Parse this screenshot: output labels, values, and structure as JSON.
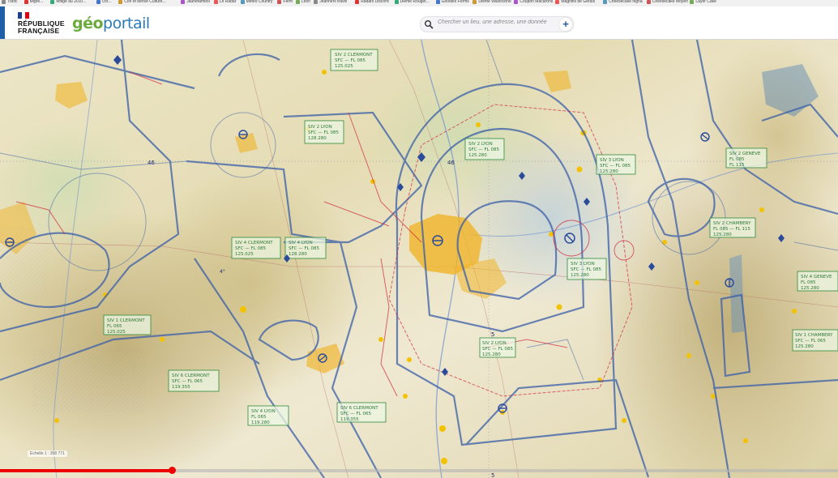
{
  "bookmarks": [
    "Trafic",
    "Migre...",
    "Mitigé au 2010...",
    "Oct...",
    "Cori et dérivé Culture...",
    "Jaunetambol",
    "Le Radar",
    "Meteo Country",
    "Ferm",
    "Leon",
    "Jeanners travel",
    "Radars Discord",
    "Dieme Rouget...",
    "Goodies Forms",
    "Dieme Wazeclone",
    "Coupon Macarons",
    "Magnifis de Gerais",
    "Cheesecake nigna",
    "Cheesecake Moyen",
    "Layer Cake"
  ],
  "header": {
    "gov_logo_line1": "RÉPUBLIQUE",
    "gov_logo_line2": "FRANÇAISE",
    "brand_prefix": "géo",
    "brand_suffix": "portail"
  },
  "search": {
    "placeholder": "Chercher un lieu, une adresse, une donnée",
    "add_label": "+"
  },
  "map": {
    "scale_label": "Echelle 1 : 358 771",
    "sectors": [
      {
        "id": "s1",
        "lines": [
          "SIV 2 CLERMONT",
          "SFC — FL 085",
          "125.025"
        ]
      },
      {
        "id": "s2",
        "lines": [
          "SIV 2 LYON",
          "SFC — FL 085",
          "128.280"
        ]
      },
      {
        "id": "s3",
        "lines": [
          "SIV 2 LYON",
          "SFC — FL 085",
          "125.280"
        ]
      },
      {
        "id": "s4",
        "lines": [
          "SIV 4 CLERMONT",
          "SFC — FL 085",
          "125.025"
        ]
      },
      {
        "id": "s5",
        "lines": [
          "SIV 4 LYON",
          "SFC — FL 085",
          "128.280"
        ]
      },
      {
        "id": "s6",
        "lines": [
          "SIV 3 LYON",
          "SFC — FL 085",
          "125.280"
        ]
      },
      {
        "id": "s7",
        "lines": [
          "SIV 1 CLERMONT",
          "FL 065",
          "125.025"
        ]
      },
      {
        "id": "s8",
        "lines": [
          "SIV 6 CLERMONT",
          "SFC — FL 065",
          "119.355"
        ]
      },
      {
        "id": "s9",
        "lines": [
          "SIV 4 LYON",
          "FL 065",
          "119.280"
        ]
      },
      {
        "id": "s10",
        "lines": [
          "SIV 6 CLERMONT",
          "SFC — FL 065",
          "119.355"
        ]
      },
      {
        "id": "s11",
        "lines": [
          "SIV 2 LYON",
          "SFC — FL 085",
          "125.280"
        ]
      },
      {
        "id": "s12",
        "lines": [
          "SIV 2 GENEVE",
          "FL 085",
          "FL 115"
        ]
      },
      {
        "id": "s13",
        "lines": [
          "SIV 2 CHAMBERY",
          "FL 085 — FL 115",
          "125.280"
        ]
      },
      {
        "id": "s14",
        "lines": [
          "SIV 4 GENEVE",
          "FL 085",
          "125.280"
        ]
      },
      {
        "id": "s15",
        "lines": [
          "SIV 1 CHAMBERY",
          "SFC — FL 065",
          "125.280"
        ]
      },
      {
        "id": "s16",
        "lines": [
          "SIV 3 LYON",
          "SFC — FL 085",
          "125.280"
        ]
      }
    ],
    "meridian_labels": [
      "46",
      "46",
      "5",
      "5",
      "4°"
    ]
  },
  "video": {
    "progress_fraction": 0.205
  },
  "colors": {
    "header_bg": "#ffffff",
    "brand_green": "#6bab3c",
    "brand_blue": "#2a7ab8",
    "airspace_blue": "#3a5fa8",
    "airspace_red": "#d0283c",
    "sector_green": "#2f8a3a",
    "progress_red": "#ee0000",
    "city_yellow": "#f0b429"
  }
}
